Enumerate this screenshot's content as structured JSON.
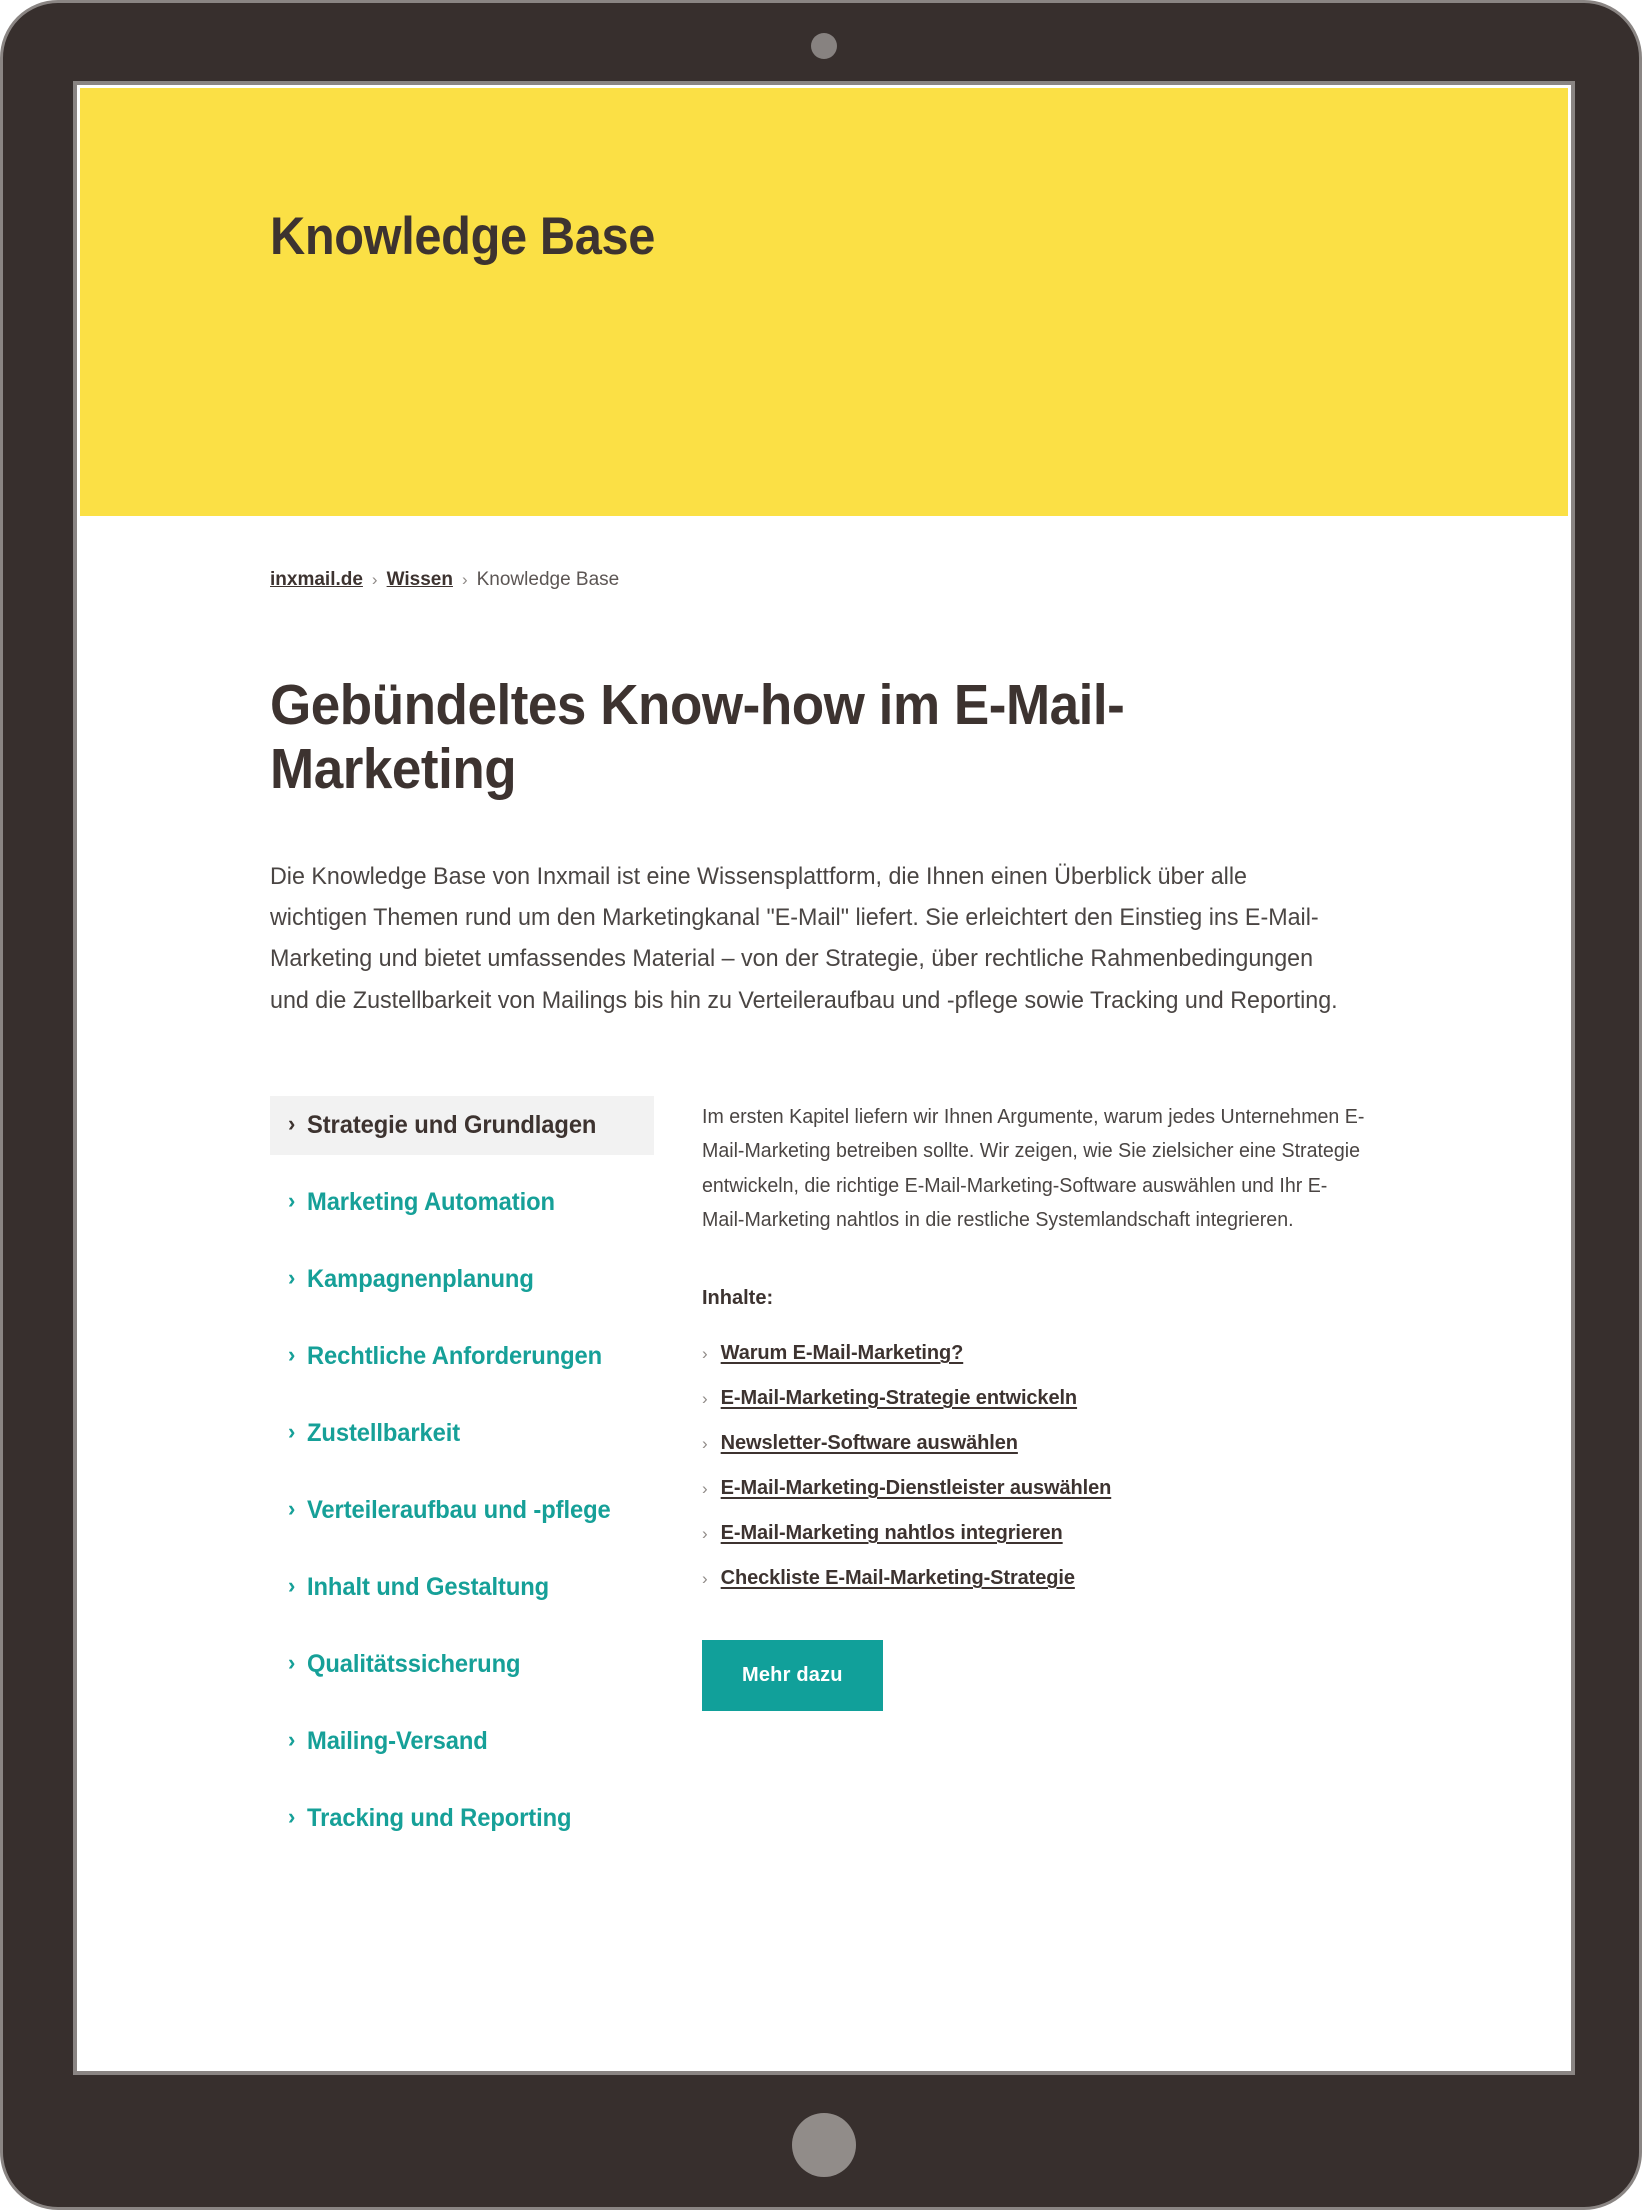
{
  "device": {
    "type": "tablet",
    "camera_icon": "camera-dot-icon",
    "home_icon": "home-button-icon",
    "bezel_color": "#372F2D",
    "frame_outline_color": "#8A8583"
  },
  "hero": {
    "title": "Knowledge Base",
    "background_color": "#FBE045",
    "text_color": "#3D3330"
  },
  "breadcrumb": {
    "items": [
      {
        "label": "inxmail.de",
        "link": true
      },
      {
        "label": "Wissen",
        "link": true
      },
      {
        "label": "Knowledge Base",
        "link": false
      }
    ],
    "separator": "›"
  },
  "page": {
    "title": "Gebündeltes Know-how im E-Mail-Marketing",
    "intro": "Die Knowledge Base von Inxmail ist eine Wissensplattform, die Ihnen einen Überblick über alle wichtigen Themen rund um den Marketingkanal \"E-Mail\" liefert. Sie erleichtert den Einstieg ins E-Mail-Marketing und bietet umfassendes Material – von der Strategie, über rechtliche Rahmenbedingungen und die Zustellbarkeit von Mailings bis hin zu Verteileraufbau und -pflege sowie Tracking und Reporting."
  },
  "sidebar": {
    "accent_color": "#16A098",
    "active_background": "#F2F2F2",
    "active_text_color": "#3D3330",
    "chevron_icon": "chevron-right-icon",
    "items": [
      {
        "label": "Strategie und Grundlagen",
        "active": true
      },
      {
        "label": "Marketing Automation",
        "active": false
      },
      {
        "label": "Kampagnenplanung",
        "active": false
      },
      {
        "label": "Rechtliche Anforderungen",
        "active": false
      },
      {
        "label": "Zustellbarkeit",
        "active": false
      },
      {
        "label": "Verteileraufbau und -pflege",
        "active": false
      },
      {
        "label": "Inhalt und Gestaltung",
        "active": false
      },
      {
        "label": "Qualitätssicherung",
        "active": false
      },
      {
        "label": "Mailing-Versand",
        "active": false
      },
      {
        "label": "Tracking und Reporting",
        "active": false
      }
    ]
  },
  "content": {
    "description": "Im ersten Kapitel liefern wir Ihnen Argumente, warum jedes Unternehmen E-Mail-Marketing betreiben sollte. Wir zeigen, wie Sie zielsicher eine Strategie entwickeln, die richtige E-Mail-Marketing-Software auswählen und Ihr E-Mail-Marketing nahtlos in die restliche Systemlandschaft integrieren.",
    "list_heading": "Inhalte:",
    "chevron_icon": "chevron-right-icon",
    "links": [
      {
        "label": "Warum E-Mail-Marketing?"
      },
      {
        "label": "E-Mail-Marketing-Strategie entwickeln"
      },
      {
        "label": "Newsletter-Software auswählen"
      },
      {
        "label": "E-Mail-Marketing-Dienstleister auswählen"
      },
      {
        "label": "E-Mail-Marketing nahtlos integrieren"
      },
      {
        "label": "Checkliste E-Mail-Marketing-Strategie"
      }
    ],
    "cta_label": "Mehr dazu",
    "cta_color": "#11A09A"
  }
}
